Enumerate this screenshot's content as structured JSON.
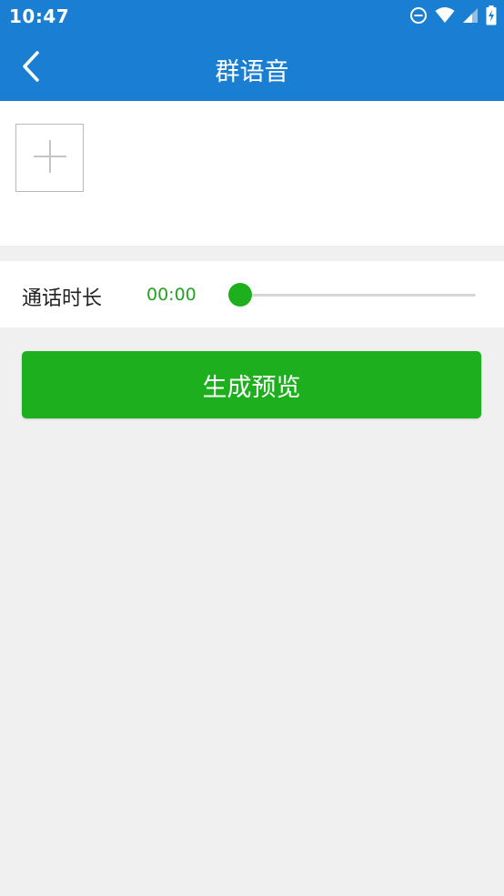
{
  "status_bar": {
    "time": "10:47",
    "icons": [
      "do-not-disturb-icon",
      "wifi-icon",
      "signal-icon",
      "battery-charging-icon"
    ]
  },
  "app_bar": {
    "title": "群语音",
    "back_icon": "chevron-left-icon"
  },
  "media": {
    "add_icon": "plus-icon"
  },
  "duration": {
    "label": "通话时长",
    "value": "00:00",
    "slider_progress": 0
  },
  "actions": {
    "generate_label": "生成预览"
  },
  "colors": {
    "primary": "#1a7fd2",
    "accent_green": "#1daf1d",
    "background": "#f0f0f0"
  }
}
